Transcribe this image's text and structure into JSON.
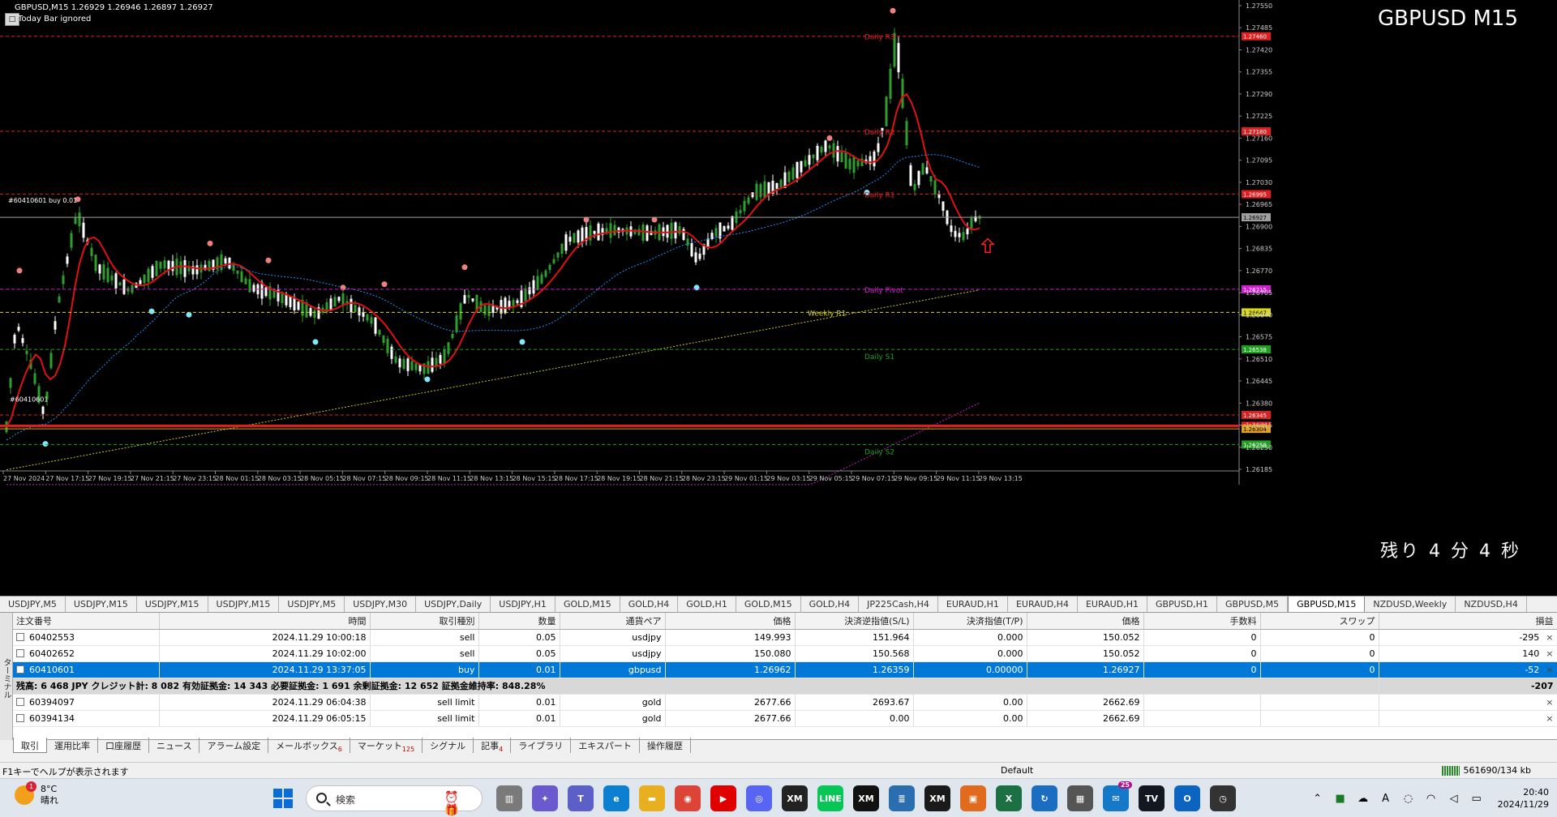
{
  "chart": {
    "symbol_line": "GBPUSD,M15  1.26929 1.26946 1.26897 1.26927",
    "note": "Today Bar ignored",
    "corner_button": "□",
    "title": "GBPUSD M15",
    "countdown": "残り 4 分 4 秒",
    "order_label": "#60410601 buy 0.01",
    "order_label_short": "#60410601",
    "colors": {
      "background": "#000000",
      "bull": "#2e9e2e",
      "bear": "#ffffff",
      "ma_fast": "#e01010",
      "ma_slow": "#1e90ff",
      "ma_long": "#c8c820",
      "ma_long2": "#c020c0",
      "fractal_up": "#f08080",
      "fractal_down": "#7fe8ff",
      "arrow": "#ff2020"
    },
    "price_axis": [
      "1.27550",
      "1.27485",
      "1.27420",
      "1.27355",
      "1.27290",
      "1.27225",
      "1.27160",
      "1.27095",
      "1.27030",
      "1.26965",
      "1.26900",
      "1.26835",
      "1.26770",
      "1.26705",
      "1.26640",
      "1.26575",
      "1.26510",
      "1.26445",
      "1.26380",
      "1.26315",
      "1.26250",
      "1.26185"
    ],
    "time_axis": [
      "27 Nov 2024",
      "27 Nov 17:15",
      "27 Nov 19:15",
      "27 Nov 21:15",
      "27 Nov 23:15",
      "28 Nov 01:15",
      "28 Nov 03:15",
      "28 Nov 05:15",
      "28 Nov 07:15",
      "28 Nov 09:15",
      "28 Nov 11:15",
      "28 Nov 13:15",
      "28 Nov 15:15",
      "28 Nov 17:15",
      "28 Nov 19:15",
      "28 Nov 21:15",
      "28 Nov 23:15",
      "29 Nov 01:15",
      "29 Nov 03:15",
      "29 Nov 05:15",
      "29 Nov 07:15",
      "29 Nov 09:15",
      "29 Nov 11:15",
      "29 Nov 13:15"
    ],
    "levels": [
      {
        "name": "Daily R3",
        "price": 1.2746,
        "tag": "1.27460",
        "color": "#e02020",
        "style": "dash"
      },
      {
        "name": "Daily R2",
        "price": 1.2718,
        "tag": "1.27180",
        "color": "#e02020",
        "style": "dash"
      },
      {
        "name": "Daily R1",
        "price": 1.26995,
        "tag": "1.26995",
        "color": "#e02020",
        "style": "dash"
      },
      {
        "name": "",
        "price": 1.26927,
        "tag": "1.26927",
        "color": "#a0a0a0",
        "style": "solid"
      },
      {
        "name": "Daily Pivot",
        "price": 1.26715,
        "tag": "1.26715",
        "color": "#d020d0",
        "style": "dash"
      },
      {
        "name": "Weekly R1",
        "price": 1.26647,
        "tag": "1.26647",
        "color": "#d8d820",
        "style": "dash"
      },
      {
        "name": "Daily S1",
        "price": 1.26538,
        "tag": "1.26538",
        "color": "#20a020",
        "style": "dash"
      },
      {
        "name": "",
        "price": 1.26345,
        "tag": "1.26345",
        "color": "#e02020",
        "style": "dash"
      },
      {
        "name": "",
        "price": 1.26313,
        "tag": "1.26313",
        "color": "#e02020",
        "style": "solid"
      },
      {
        "name": "",
        "price": 1.26304,
        "tag": "1.26304",
        "color": "#e0a020",
        "style": "solid"
      },
      {
        "name": "Daily S2",
        "price": 1.26258,
        "tag": "1.26258",
        "color": "#20a020",
        "style": "dash"
      }
    ]
  },
  "chart_tabs": [
    "USDJPY,M5",
    "USDJPY,M15",
    "USDJPY,M15",
    "USDJPY,M15",
    "USDJPY,M5",
    "USDJPY,M30",
    "USDJPY,Daily",
    "USDJPY,H1",
    "GOLD,M15",
    "GOLD,H4",
    "GOLD,H1",
    "GOLD,M15",
    "GOLD,H4",
    "JP225Cash,H4",
    "EURAUD,H1",
    "EURAUD,H4",
    "EURAUD,H1",
    "GBPUSD,H1",
    "GBPUSD,M5",
    "GBPUSD,M15",
    "NZDUSD,Weekly",
    "NZDUSD,H4"
  ],
  "active_tab": 19,
  "terminal": {
    "side_label": "ターミナル",
    "columns": [
      "注文番号",
      "時間",
      "取引種別",
      "数量",
      "通貨ペア",
      "価格",
      "決済逆指値(S/L)",
      "決済指値(T/P)",
      "価格",
      "手数料",
      "スワップ",
      "損益"
    ],
    "rows": [
      [
        "60402553",
        "2024.11.29 10:00:18",
        "sell",
        "0.05",
        "usdjpy",
        "149.993",
        "151.964",
        "0.000",
        "150.052",
        "0",
        "0",
        "-295"
      ],
      [
        "60402652",
        "2024.11.29 10:02:00",
        "sell",
        "0.05",
        "usdjpy",
        "150.080",
        "150.568",
        "0.000",
        "150.052",
        "0",
        "0",
        "140"
      ],
      [
        "60410601",
        "2024.11.29 13:37:05",
        "buy",
        "0.01",
        "gbpusd",
        "1.26962",
        "1.26359",
        "0.00000",
        "1.26927",
        "0",
        "0",
        "-52"
      ]
    ],
    "summary": {
      "text": "残高: 6 468 JPY  クレジット計: 8 082  有効証拠金: 14 343  必要証拠金: 1 691  余剰証拠金: 12 652  証拠金維持率: 848.28%",
      "value": "-207"
    },
    "pending": [
      [
        "60394097",
        "2024.11.29 06:04:38",
        "sell limit",
        "0.01",
        "gold",
        "2677.66",
        "2693.67",
        "0.00",
        "2662.69",
        "",
        "",
        ""
      ],
      [
        "60394134",
        "2024.11.29 06:05:15",
        "sell limit",
        "0.01",
        "gold",
        "2677.66",
        "0.00",
        "0.00",
        "2662.69",
        "",
        "",
        ""
      ]
    ],
    "close_icon": "×"
  },
  "bottom_tabs": [
    {
      "label": "取引",
      "badge": ""
    },
    {
      "label": "運用比率",
      "badge": ""
    },
    {
      "label": "口座履歴",
      "badge": ""
    },
    {
      "label": "ニュース",
      "badge": ""
    },
    {
      "label": "アラーム設定",
      "badge": ""
    },
    {
      "label": "メールボックス",
      "badge": "6"
    },
    {
      "label": "マーケット",
      "badge": "125"
    },
    {
      "label": "シグナル",
      "badge": ""
    },
    {
      "label": "記事",
      "badge": "4"
    },
    {
      "label": "ライブラリ",
      "badge": ""
    },
    {
      "label": "エキスパート",
      "badge": ""
    },
    {
      "label": "操作履歴",
      "badge": ""
    }
  ],
  "status": {
    "help": "F1キーでヘルプが表示されます",
    "profile": "Default",
    "traffic": "561690/134 kb"
  },
  "taskbar": {
    "weather_temp": "8°C",
    "weather_desc": "晴れ",
    "weather_badge": "1",
    "search_placeholder": "検索",
    "search_deco": "⏰🎁",
    "apps": [
      {
        "icon": "file-explorer-icon",
        "label": "▥",
        "bg": "#7a7a7a"
      },
      {
        "icon": "copilot-icon",
        "label": "✦",
        "bg": "#6a5acd"
      },
      {
        "icon": "teams-icon",
        "label": "T",
        "bg": "#5b5fc7"
      },
      {
        "icon": "edge-icon",
        "label": "e",
        "bg": "#0c7fd0"
      },
      {
        "icon": "folder-icon",
        "label": "▬",
        "bg": "#e8b020"
      },
      {
        "icon": "chrome-icon",
        "label": "◉",
        "bg": "#db4437"
      },
      {
        "icon": "youtube-icon",
        "label": "▶",
        "bg": "#e00000"
      },
      {
        "icon": "discord-icon",
        "label": "◎",
        "bg": "#5865f2"
      },
      {
        "icon": "xm-icon",
        "label": "XM",
        "bg": "#222222"
      },
      {
        "icon": "line-icon",
        "label": "LINE",
        "bg": "#06c755"
      },
      {
        "icon": "xm2-icon",
        "label": "XM",
        "bg": "#111111"
      },
      {
        "icon": "notepad-icon",
        "label": "≣",
        "bg": "#2a6eb0"
      },
      {
        "icon": "xm3-icon",
        "label": "XM",
        "bg": "#1a1a1a"
      },
      {
        "icon": "store-icon",
        "label": "▣",
        "bg": "#e06b1f"
      },
      {
        "icon": "excel-icon",
        "label": "X",
        "bg": "#1d7044"
      },
      {
        "icon": "sync-icon",
        "label": "↻",
        "bg": "#1b6dc1"
      },
      {
        "icon": "calculator-icon",
        "label": "▦",
        "bg": "#555555"
      },
      {
        "icon": "mail-icon",
        "label": "✉",
        "bg": "#1679c8",
        "badge": "25"
      },
      {
        "icon": "tradingview-icon",
        "label": "TV",
        "bg": "#131722"
      },
      {
        "icon": "outlook-icon",
        "label": "O",
        "bg": "#0a64c0"
      },
      {
        "icon": "clock-icon",
        "label": "◷",
        "bg": "#333333"
      }
    ],
    "time": "20:40",
    "date": "2024/11/29",
    "ime": "A"
  }
}
